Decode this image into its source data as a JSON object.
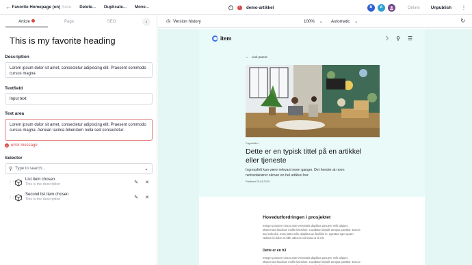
{
  "topbar": {
    "back_icon": "arrow-left-icon",
    "title": "Favorite Homepage (en)",
    "save": "Save",
    "delete": "Delete...",
    "duplicate": "Duplicate...",
    "move": "Move...",
    "slug": "demo-artikkel",
    "avatars": [
      {
        "letter": "B",
        "color": "#2f5fd0"
      },
      {
        "letter": "A",
        "color": "#2f9fd0"
      },
      {
        "letter": "",
        "color": "#7a4fa0"
      }
    ],
    "status": "Online",
    "unpublish": "Unpublish",
    "menu_icon": "more-vertical-icon"
  },
  "editor": {
    "tabs": [
      {
        "label": "Article",
        "active": true,
        "has_error": true
      },
      {
        "label": "Page",
        "active": false
      },
      {
        "label": "SEO",
        "active": false
      }
    ],
    "heading": "This is my favorite heading",
    "description_label": "Description",
    "description_value": "Lorem ipsum dolor sit amet, consectetur adipiscing elit. Praesent commodo cursus magna",
    "textfield_label": "Textfield",
    "textfield_value": "Input text",
    "textarea_label": "Text area",
    "textarea_value": "Lorem ipsum dolor sit amet, consectetur adipiscing elit. Praesent commodo cursus magna. Aenean lacinia bibendum nulla sed consectetur.",
    "error_message": "error message",
    "selector_label": "Selector",
    "selector_placeholder": "Type to search...",
    "items": [
      {
        "title": "List item chosen",
        "desc": "This is the description"
      },
      {
        "title": "Second list item chosen",
        "desc": "This is the description"
      }
    ]
  },
  "preview": {
    "version_history": "Version history",
    "zoom": "100%",
    "device": "Automatic",
    "site": {
      "logo": "item",
      "link_parent": "Link parent",
      "kicker": "Fagartikkel",
      "title": "Dette er en typisk tittel på en artikkel eller tjeneste",
      "intro": "Ingressfelt kan være relevant noen ganger. Det hender at noen nettredaktører skriver en hel artikkel her.",
      "date": "Publisert 20.04.2023",
      "h2": "Hovedutfordringen i prosjektet",
      "para1": "Integer posuere erat a ante venenatis dapibus posuere velit aliquet. Maecenas faucibus mollis interdum. Curabitur blandit tempus porttitor. Donec sed odio dui. Cras justo odio, dapibus ac facilisis in, egestas eget quam. Nullam id dolor id nibh ultricies vehicula ut id elit.",
      "h3": "Dette er en h3",
      "para2": "Integer posuere erat a ante venenatis dapibus posuere velit aliquet. Maecenas faucibus mollis interdum. Curabitur blandit tempus porttitor. Donec sed odio dui. Cras justo odio, dapibus ac facilisis in, egestas eget quam. Nullam id dolor id nibh ultricies vehicula ut id elit."
    }
  }
}
